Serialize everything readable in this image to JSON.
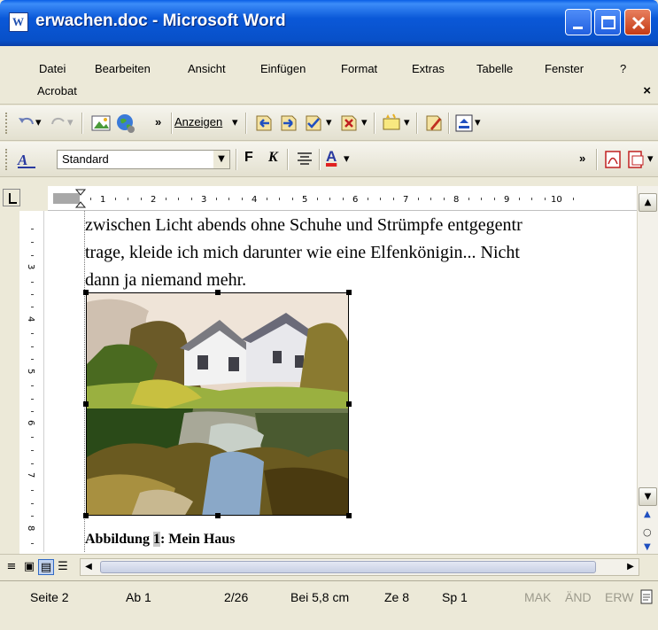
{
  "window": {
    "title": "erwachen.doc - Microsoft Word"
  },
  "menu": {
    "items": [
      "Datei",
      "Bearbeiten",
      "Ansicht",
      "Einfügen",
      "Format",
      "Extras",
      "Tabelle",
      "Fenster",
      "?"
    ],
    "second_row": "Acrobat",
    "close": "×"
  },
  "toolbar1": {
    "show_label": "Anzeigen",
    "overflow": "»"
  },
  "toolbar2": {
    "style_value": "Standard",
    "bold": "F",
    "italic": "K",
    "font_color_letter": "A",
    "overflow": "»"
  },
  "ruler": {
    "numbers": [
      "1",
      "2",
      "3",
      "4",
      "5",
      "6",
      "7",
      "8",
      "9",
      "10"
    ],
    "vnumbers": [
      "3",
      "4",
      "5",
      "6",
      "7",
      "8"
    ]
  },
  "document": {
    "lines": [
      "zwischen Licht abends ohne Schuhe und Strümpfe entgegentr",
      "trage, kleide ich mich darunter wie eine Elfenkönigin... Nicht",
      "dann ja niemand mehr."
    ],
    "caption_prefix": "Abbildung ",
    "caption_number": "1",
    "caption_suffix": ": Mein Haus"
  },
  "status": {
    "page": "Seite 2",
    "section": "Ab 1",
    "pages": "2/26",
    "position": "Bei 5,8 cm",
    "line": "Ze 8",
    "column": "Sp 1",
    "mak": "MAK",
    "and": "ÄND",
    "erw": "ERW"
  },
  "colors": {
    "title_blue": "#0a58d8",
    "chrome": "#ece9d8",
    "close_red": "#c43a14"
  }
}
